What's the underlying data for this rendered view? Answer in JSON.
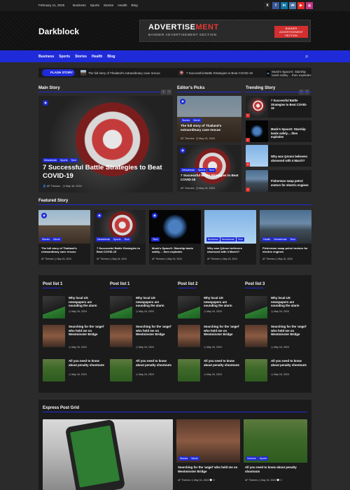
{
  "topbar": {
    "date": "February 11, 2025",
    "links": [
      "Business",
      "Sports",
      "Stories",
      "Health",
      "Blog"
    ],
    "social": [
      {
        "icon": "x-icon",
        "glyph": "X",
        "color": "#222222"
      },
      {
        "icon": "facebook-icon",
        "glyph": "f",
        "color": "#3b5998"
      },
      {
        "icon": "linkedin-icon",
        "glyph": "in",
        "color": "#0e76a8"
      },
      {
        "icon": "vk-icon",
        "glyph": "vk",
        "color": "#4a76a8"
      },
      {
        "icon": "youtube-icon",
        "glyph": "▶",
        "color": "#e52d27"
      },
      {
        "icon": "instagram-icon",
        "glyph": "◎",
        "color": "#c13584"
      }
    ]
  },
  "header": {
    "logo": "Darkblock",
    "ad_title_a": "ADVERTISE",
    "ad_title_b": "MENT",
    "ad_subtitle": "BANNER ADVERTISEMENT SECTION",
    "ad_badge": "BANNER ADVERTISEMENT SECTION"
  },
  "nav": {
    "items": [
      "Business",
      "Sports",
      "Stories",
      "Health",
      "Blog"
    ]
  },
  "flash": {
    "label": "FLASH STORY",
    "items": [
      "The full story of Thailand's extraordinary cave rescue",
      "7 Successful Battle Strategies to Beat COVID-19",
      "Musk's SpaceX: Starship lands safely… then explodes"
    ]
  },
  "main_story": {
    "heading": "Main Story",
    "cats": [
      "Newsbreak",
      "Sports",
      "Tech"
    ],
    "title": "7 Successful Battle Strategies to Beat COVID-19",
    "author": "AF Themes",
    "date": "May 16, 2024"
  },
  "editors": {
    "heading": "Editor's Picks",
    "items": [
      {
        "cats": [
          "Stories",
          "World"
        ],
        "title": "The full story of Thailand's extraordinary cave rescue",
        "author": "AF Themes",
        "date": "May 16, 2024"
      },
      {
        "cats": [
          "Newsbreak",
          "Sports",
          "Tech"
        ],
        "title": "7 Successful Battle Strategies to Beat COVID-19",
        "author": "AF Themes",
        "date": "May 16, 2024"
      }
    ]
  },
  "trending": {
    "heading": "Trending Story",
    "items": [
      {
        "num": "1",
        "title": "7 Successful Battle Strategies to Beat COVID-19"
      },
      {
        "num": "2",
        "title": "Musk's SpaceX: Starship lands safely… then explodes"
      },
      {
        "num": "3",
        "title": "Why was QAnon believers obsessed with 4 March?"
      },
      {
        "num": "4",
        "title": "Fisherman swap petrol motors for electric engines"
      }
    ]
  },
  "featured": {
    "heading": "Featured Story",
    "items": [
      {
        "cats": [
          "Stories",
          "World"
        ],
        "title": "The full story of Thailand's extraordinary cave rescue",
        "author": "AF Themes",
        "date": "May 16, 2024"
      },
      {
        "cats": [
          "Newsbreak",
          "Sports",
          "Tech"
        ],
        "title": "7 Successful Battle Strategies to Beat COVID-19",
        "author": "AF Themes",
        "date": "May 16, 2024"
      },
      {
        "cats": [
          "Tech"
        ],
        "title": "Musk's SpaceX: Starship lands safely… then explodes",
        "author": "AF Themes",
        "date": "May 16, 2024"
      },
      {
        "cats": [
          "Business",
          "Newsbreak",
          "Tech"
        ],
        "title": "Why was QAnon believers obsessed with 4 March?",
        "author": "AF Themes",
        "date": "May 16, 2024"
      },
      {
        "cats": [
          "Health",
          "Newsbreak",
          "Tech"
        ],
        "title": "Fisherman swap petrol motors for electric engines",
        "author": "AF Themes",
        "date": "May 16, 2024"
      }
    ]
  },
  "post_lists": {
    "headings": [
      "Post list 1",
      "Post list 1",
      "Post list 2",
      "Post list 3"
    ],
    "items": [
      {
        "title": "Why local US newspapers are sounding the alarm",
        "date": "May 16, 2024"
      },
      {
        "title": "Searching for the 'angel' who held me on Westminster Bridge",
        "date": "May 16, 2024"
      },
      {
        "title": "All you need to know about penalty shootouts",
        "date": "May 16, 2024"
      }
    ]
  },
  "express": {
    "heading": "Express Post Grid",
    "items": [
      {
        "cats": [
          "Stories",
          "World"
        ],
        "title": "Searching for the 'angel' who held me on Westminster Bridge",
        "author": "AF Themes",
        "date": "May 16, 2024",
        "comments": "0"
      },
      {
        "cats": [
          "Science",
          "Sports"
        ],
        "title": "All you need to know about penalty shootouts",
        "author": "AF Themes",
        "date": "May 16, 2024",
        "comments": "0"
      }
    ]
  }
}
